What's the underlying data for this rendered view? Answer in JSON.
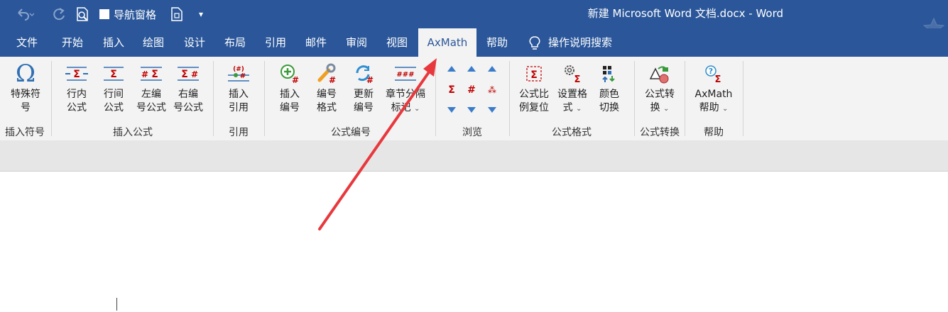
{
  "titlebar": {
    "nav_pane_label": "导航窗格",
    "title": "新建 Microsoft Word 文档.docx  -  Word"
  },
  "tabs": [
    "文件",
    "开始",
    "插入",
    "绘图",
    "设计",
    "布局",
    "引用",
    "邮件",
    "审阅",
    "视图",
    "AxMath",
    "帮助"
  ],
  "tell_me": "操作说明搜索",
  "ribbon": {
    "groups": {
      "insert_symbol": "插入符号",
      "insert_formula": "插入公式",
      "cite": "引用",
      "formula_number": "公式编号",
      "browse": "浏览",
      "formula_format": "公式格式",
      "formula_convert": "公式转换",
      "help": "帮助"
    },
    "buttons": {
      "special_symbol": "特殊符\n号",
      "inline_formula": "行内\n公式",
      "display_formula": "行间\n公式",
      "left_numbered": "左编\n号公式",
      "right_numbered": "右编\n号公式",
      "insert_ref": "插入\n引用",
      "insert_number": "插入\n编号",
      "number_format": "编号\n格式",
      "update_number": "更新\n编号",
      "chapter_separator": "章节分隔\n标记",
      "formula_scale": "公式比\n例复位",
      "settings_format": "设置格\n式",
      "color_switch": "颜色\n切换",
      "formula_convert": "公式转\n换",
      "axmath_help": "AxMath\n帮助"
    }
  },
  "colors": {
    "title_blue": "#2b579a",
    "ribbon_bg": "#f3f3f3",
    "arrow_red": "#e8383d"
  }
}
